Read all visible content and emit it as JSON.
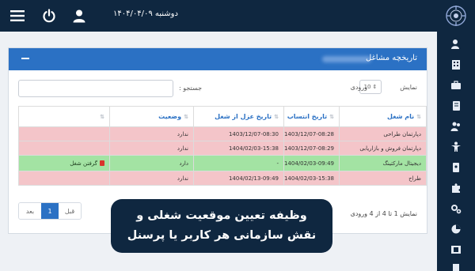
{
  "topbar": {
    "date": "دوشنبه ۱۴۰۴/۰۴/۰۹"
  },
  "panel": {
    "title": "تاریخچه مشاغل",
    "show_label_pre": "نمایش",
    "show_label_post": "ورودی",
    "page_length": "10",
    "search_label": "جستجو :"
  },
  "table": {
    "headers": [
      "نام شغل",
      "تاریخ انتساب",
      "تاریخ عزل از شغل",
      "وضعیت",
      ""
    ],
    "rows": [
      {
        "job": "دپارتمان طراحی",
        "assigned": "1403/12/07-08:28",
        "removed": "1403/12/07-08:30",
        "status": "ندارد",
        "action": ""
      },
      {
        "job": "دپارتمان فروش و بازاریابی",
        "assigned": "1403/12/07-08:29",
        "removed": "1404/02/03-15:38",
        "status": "ندارد",
        "action": ""
      },
      {
        "job": "دیجیتال مارکتینگ",
        "assigned": "1404/02/03-09:49",
        "removed": "-",
        "status": "دارد",
        "action": "گرفتن شغل"
      },
      {
        "job": "طراح",
        "assigned": "1404/02/03-15:38",
        "removed": "1404/02/13-09:49",
        "status": "ندارد",
        "action": ""
      }
    ]
  },
  "pagination": {
    "info": "نمایش 1 تا 4 از 4 ورودی",
    "prev": "قبل",
    "current": "1",
    "next": "بعد"
  },
  "caption": {
    "line1": "وظیفه تعیین موقعیت شغلی و",
    "line2": "نقش سازمانی هر کاربر یا پرسنل"
  },
  "colors": {
    "navy": "#0f2740",
    "primary": "#2b71c4",
    "row_inactive": "#f4c5c9",
    "row_active": "#a3e3a3"
  }
}
